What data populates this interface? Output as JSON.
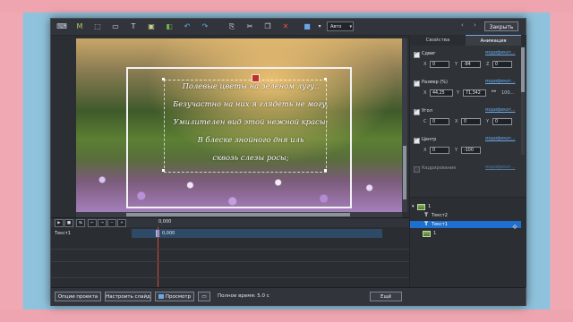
{
  "toolbar": {
    "zoom_value": "Авто",
    "close_label": "Закрыть",
    "nav_prev": "‹",
    "nav_next": "›"
  },
  "preview": {
    "poem_lines": [
      "Полевые цветы на зеленом лугу..",
      "Безучастно на них я глядеть не могу.",
      "Умилителен вид этой нежной красы:",
      "В блеске знойного дня иль",
      "сквозь слезы росы;"
    ]
  },
  "panel": {
    "tabs": [
      "Свойства",
      "Анимация"
    ],
    "active_tab": "Анимация",
    "sections": [
      {
        "label": "Сдвиг",
        "checked": true,
        "link": "модификат...",
        "fields": [
          {
            "label": "X",
            "value": "0"
          },
          {
            "label": "Y",
            "value": "-84"
          },
          {
            "label": "Z",
            "value": "0"
          }
        ]
      },
      {
        "label": "Размер (%)",
        "checked": true,
        "link": "модификат...",
        "fields": [
          {
            "label": "X",
            "value": "44,25"
          },
          {
            "label": "Y",
            "value": "71,342"
          },
          {
            "label": "",
            "value": "100..."
          }
        ]
      },
      {
        "label": "Угол",
        "checked": true,
        "link": "модификат...",
        "fields": [
          {
            "label": "C",
            "value": "0"
          },
          {
            "label": "X",
            "value": "0"
          },
          {
            "label": "Y",
            "value": "0"
          }
        ]
      },
      {
        "label": "Центр",
        "checked": true,
        "link": "модификат...",
        "fields": [
          {
            "label": "X",
            "value": "0"
          },
          {
            "label": "Y",
            "value": "-100"
          }
        ]
      },
      {
        "label": "Кадрирование",
        "checked": false,
        "link": "модификат...",
        "fields": []
      }
    ]
  },
  "layers": {
    "items": [
      {
        "label": "1",
        "type": "image",
        "selected": false
      },
      {
        "label": "Текст2",
        "type": "text",
        "selected": false
      },
      {
        "label": "Текст1",
        "type": "text",
        "selected": true
      },
      {
        "label": "1",
        "type": "image",
        "selected": false
      }
    ]
  },
  "timeline": {
    "time_label": "0,000",
    "track_label": "Текст1",
    "track_value": "0,000",
    "buttons": [
      "▶",
      "■",
      "↹",
      "←",
      "→",
      "−",
      "+"
    ]
  },
  "bottombar": {
    "options_label": "Опции проекта",
    "slide_settings_label": "Настроить слайд",
    "preview_label": "Просмотр",
    "total_time_label": "Полное время: 5.0 с",
    "more_label": "Ещё"
  },
  "colors": {
    "accent": "#1f6fd1",
    "link": "#6aa7e6",
    "background": "#2b2e33",
    "frame": "#f0a9b3"
  }
}
